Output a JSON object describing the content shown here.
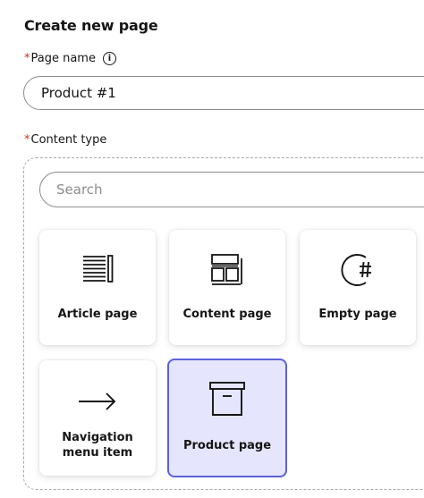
{
  "header": {
    "title": "Create new page"
  },
  "page_name": {
    "required_mark": "*",
    "label": "Page name",
    "info_glyph": "i",
    "value": "Product #1"
  },
  "content_type": {
    "required_mark": "*",
    "label": "Content type",
    "search_placeholder": "Search",
    "tiles": [
      {
        "label": "Article page",
        "icon": "article-icon"
      },
      {
        "label": "Content page",
        "icon": "layout-icon"
      },
      {
        "label": "Empty page",
        "icon": "hash-circle-icon"
      },
      {
        "label": "Navigation menu item",
        "icon": "arrow-right-icon"
      },
      {
        "label": "Product page",
        "icon": "archive-box-icon",
        "selected": true
      }
    ]
  },
  "colors": {
    "required": "#d4321f",
    "selected_bg": "#e5e5fd",
    "selected_border": "#5b62d9"
  }
}
